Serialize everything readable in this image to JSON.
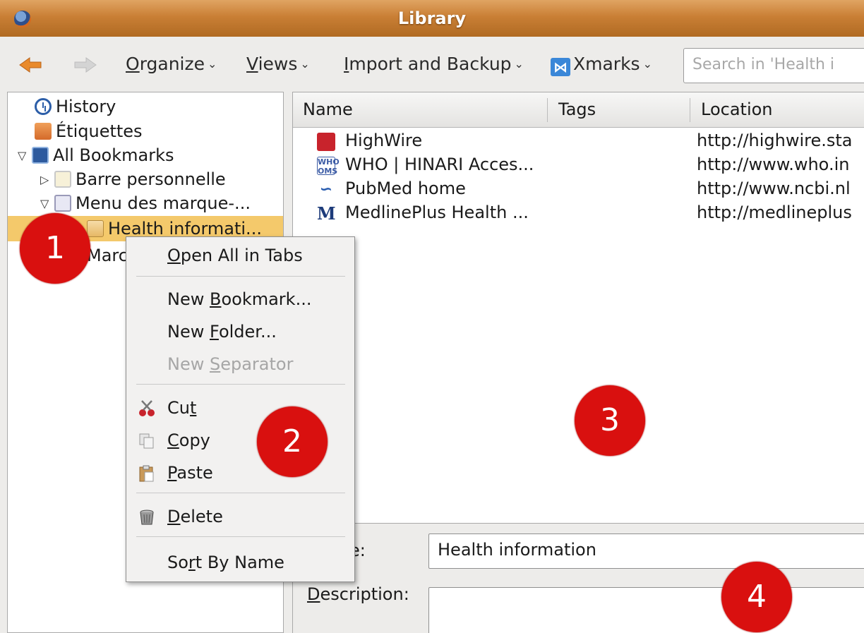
{
  "window": {
    "title": "Library"
  },
  "toolbar": {
    "organize": {
      "label": "rganize",
      "mnemonic": "O"
    },
    "views": {
      "label": "iews",
      "mnemonic": "V"
    },
    "import_backup": {
      "label": "mport and Backup",
      "mnemonic": "I"
    },
    "xmarks": {
      "label": "Xmarks"
    },
    "search_placeholder": "Search in 'Health i"
  },
  "tree": {
    "items": [
      {
        "label": "History",
        "icon": "history-icon"
      },
      {
        "label": "Étiquettes",
        "icon": "tags-icon"
      },
      {
        "label": "All Bookmarks",
        "icon": "all-bookmarks-icon"
      },
      {
        "label": "Barre personnelle",
        "icon": "folder-icon"
      },
      {
        "label": "Menu des marque-...",
        "icon": "folder-icon"
      },
      {
        "label": "Health informati...",
        "icon": "folder-icon"
      },
      {
        "label": "Marc",
        "icon": "folder-icon"
      }
    ]
  },
  "list": {
    "columns": [
      "Name",
      "Tags",
      "Location"
    ],
    "rows": [
      {
        "name": "HighWire",
        "location": "http://highwire.sta",
        "icon": "highwire-icon"
      },
      {
        "name": "WHO | HINARI Acces...",
        "location": "http://www.who.in",
        "icon": "who-icon"
      },
      {
        "name": "PubMed home",
        "location": "http://www.ncbi.nl",
        "icon": "pubmed-icon"
      },
      {
        "name": "MedlinePlus Health ...",
        "location": "http://medlineplus",
        "icon": "medlineplus-icon"
      }
    ]
  },
  "details": {
    "name_label": "e:",
    "name_value": "Health information",
    "description_label": "escription:",
    "description_mnemonic": "D"
  },
  "context_menu": {
    "open_all": {
      "pre": "",
      "mn": "O",
      "post": "pen All in Tabs"
    },
    "new_bookmark": {
      "pre": "New ",
      "mn": "B",
      "post": "ookmark..."
    },
    "new_folder": {
      "pre": "New ",
      "mn": "F",
      "post": "older..."
    },
    "new_separator": {
      "pre": "New ",
      "mn": "S",
      "post": "eparator"
    },
    "cut": {
      "pre": "Cu",
      "mn": "t",
      "post": ""
    },
    "copy": {
      "pre": "",
      "mn": "C",
      "post": "opy"
    },
    "paste": {
      "pre": "",
      "mn": "P",
      "post": "aste"
    },
    "delete": {
      "pre": "",
      "mn": "D",
      "post": "elete"
    },
    "sort_by_name": {
      "pre": "So",
      "mn": "r",
      "post": "t By Name"
    }
  },
  "callouts": [
    "1",
    "2",
    "3",
    "4"
  ],
  "colors": {
    "titlebar": "#c97f35",
    "selection": "#f4c96b",
    "callout": "#d9100f"
  }
}
